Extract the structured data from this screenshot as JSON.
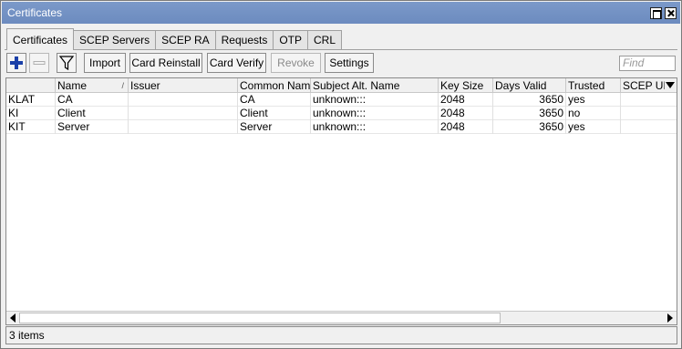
{
  "window": {
    "title": "Certificates"
  },
  "tabs": [
    {
      "label": "Certificates",
      "active": true
    },
    {
      "label": "SCEP Servers"
    },
    {
      "label": "SCEP RA"
    },
    {
      "label": "Requests"
    },
    {
      "label": "OTP"
    },
    {
      "label": "CRL"
    }
  ],
  "toolbar": {
    "import_label": "Import",
    "card_reinstall_label": "Card Reinstall",
    "card_verify_label": "Card Verify",
    "revoke_label": "Revoke",
    "settings_label": "Settings",
    "find_placeholder": "Find",
    "icons": {
      "add": "plus-icon",
      "remove": "minus-icon",
      "filter": "filter-icon"
    },
    "accent": "#1a3fa8"
  },
  "table": {
    "columns": [
      "",
      "Name",
      "Issuer",
      "Common Name",
      "Subject Alt. Name",
      "Key Size",
      "Days Valid",
      "Trusted",
      "SCEP UR"
    ],
    "rows": [
      [
        "KLAT",
        "CA",
        "",
        "CA",
        "unknown:::",
        "2048",
        "3650",
        "yes",
        ""
      ],
      [
        "KI",
        "Client",
        "",
        "Client",
        "unknown:::",
        "2048",
        "3650",
        "no",
        ""
      ],
      [
        "KIT",
        "Server",
        "",
        "Server",
        "unknown:::",
        "2048",
        "3650",
        "yes",
        ""
      ]
    ]
  },
  "status": {
    "text": "3 items"
  }
}
